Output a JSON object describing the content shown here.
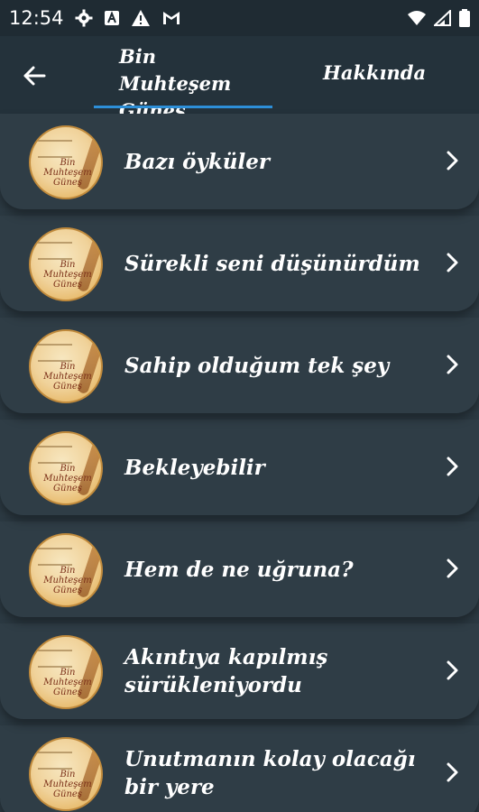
{
  "status": {
    "time": "12:54",
    "icons": [
      "gear-icon",
      "a-box-icon",
      "warning-icon",
      "gmail-icon"
    ],
    "right_icons": [
      "wifi-icon",
      "signal-icon",
      "battery-icon"
    ]
  },
  "app_bar": {
    "back_icon": "arrow-left-icon",
    "tabs": [
      {
        "label": "Bin Muhteşem Güneş",
        "selected": true
      },
      {
        "label": "Hakkında",
        "selected": false
      }
    ],
    "indicator_color": "#2d8fd8"
  },
  "thumbnail": {
    "logo_text": "Bin Muhteşem Güneş"
  },
  "items": [
    {
      "title": "Bazı öyküler"
    },
    {
      "title": "Sürekli seni düşünürdüm"
    },
    {
      "title": "Sahip olduğum tek şey"
    },
    {
      "title": "Bekleyebilir"
    },
    {
      "title": "Hem de ne uğruna?"
    },
    {
      "title": "Akıntıya kapılmış sürükleniyordu"
    },
    {
      "title": "Unutmanın kolay olacağı bir yere"
    }
  ],
  "colors": {
    "background": "#2c3a43",
    "row": "#2f3d46",
    "app_bar": "#24323b",
    "status_bar": "#1f2b33"
  }
}
